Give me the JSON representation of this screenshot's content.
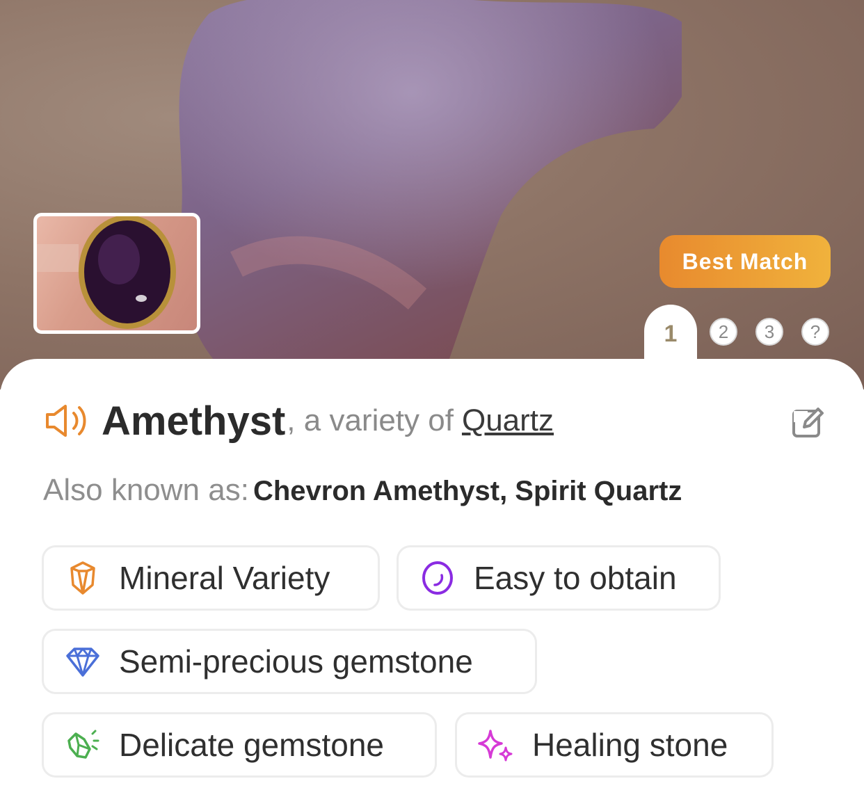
{
  "hero": {
    "badge": "Best Match",
    "pages": [
      "1",
      "2",
      "3",
      "?"
    ],
    "active_page": "1"
  },
  "result": {
    "name": "Amethyst",
    "variety_prefix": ", a variety of",
    "parent_link": "Quartz",
    "also_known_label": "Also known as:",
    "also_known_values": "Chevron Amethyst, Spirit Quartz"
  },
  "tags": [
    {
      "label": "Mineral Variety",
      "icon": "crystal-icon",
      "color": "#e8892e"
    },
    {
      "label": "Easy to obtain",
      "icon": "oval-stone-icon",
      "color": "#8a2be2"
    },
    {
      "label": "Semi-precious gemstone",
      "icon": "diamond-icon",
      "color": "#4a6fd8"
    },
    {
      "label": "Delicate gemstone",
      "icon": "broken-crystal-icon",
      "color": "#4caf50"
    },
    {
      "label": "Healing stone",
      "icon": "sparkle-icon",
      "color": "#d63ad6"
    }
  ],
  "colors": {
    "accent": "#e8892e",
    "badge_end": "#f0b23c"
  }
}
